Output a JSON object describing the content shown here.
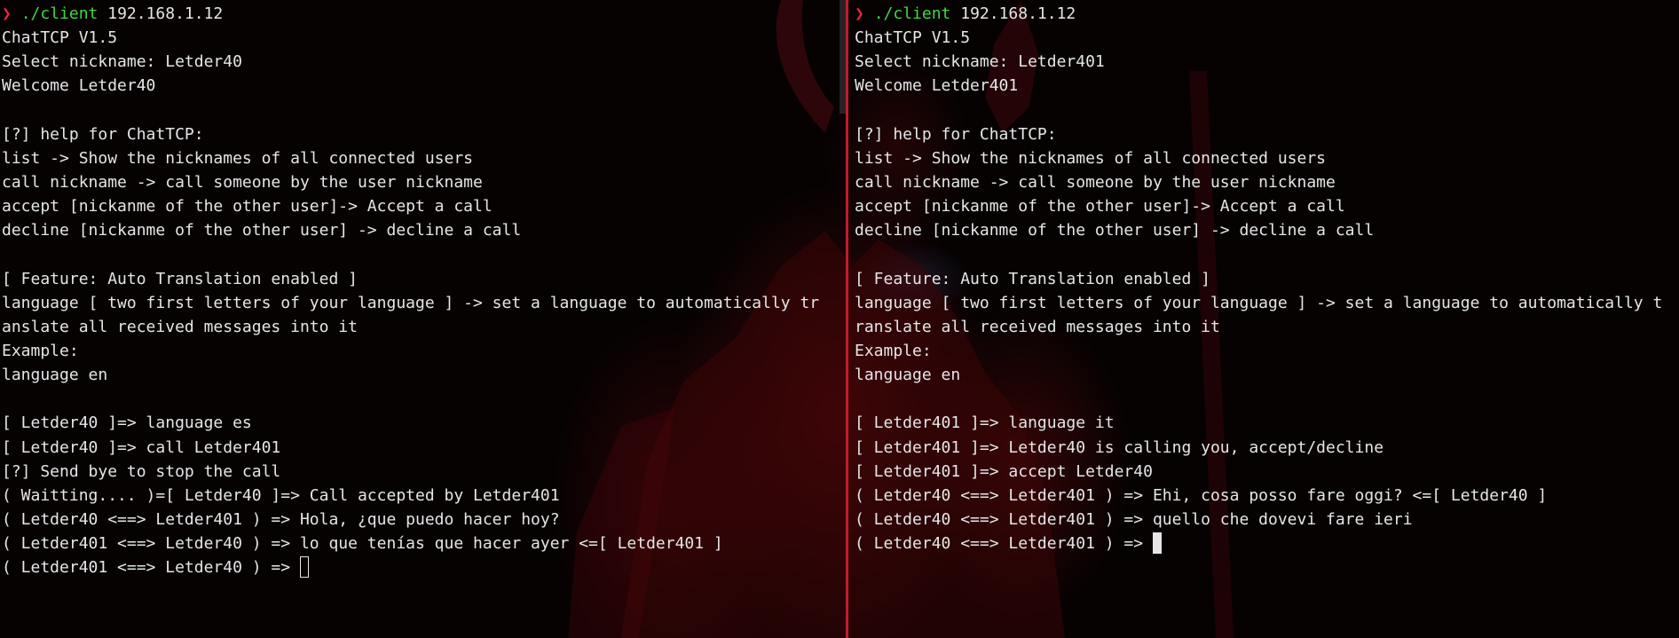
{
  "left_pane": {
    "prompt_symbol": "❯",
    "prompt_command": "./client",
    "prompt_arg": " 192.168.1.12",
    "lines": [
      "ChatTCP V1.5",
      "Select nickname: Letder40",
      "Welcome Letder40",
      "",
      "[?] help for ChatTCP:",
      "list -> Show the nicknames of all connected users",
      "call nickname -> call someone by the user nickname",
      "accept [nickanme of the other user]-> Accept a call",
      "decline [nickanme of the other user] -> decline a call",
      "",
      "[ Feature: Auto Translation enabled ]",
      "language [ two first letters of your language ] -> set a language to automatically tr",
      "anslate all received messages into it",
      "Example:",
      "language en",
      "",
      "[ Letder40 ]=> language es",
      "[ Letder40 ]=> call Letder401",
      "[?] Send bye to stop the call",
      "( Waitting.... )=[ Letder40 ]=> Call accepted by Letder401",
      "( Letder40 <==> Letder401 ) => Hola, ¿que puedo hacer hoy?",
      "( Letder401 <==> Letder40 ) => lo que tenías que hacer ayer <=[ Letder401 ]"
    ],
    "input_prompt": "( Letder401 <==> Letder40 ) => "
  },
  "right_pane": {
    "prompt_symbol": "❯",
    "prompt_command": "./client",
    "prompt_arg": " 192.168.1.12",
    "lines": [
      "ChatTCP V1.5",
      "Select nickname: Letder401",
      "Welcome Letder401",
      "",
      "[?] help for ChatTCP:",
      "list -> Show the nicknames of all connected users",
      "call nickname -> call someone by the user nickname",
      "accept [nickanme of the other user]-> Accept a call",
      "decline [nickanme of the other user] -> decline a call",
      "",
      "[ Feature: Auto Translation enabled ]",
      "language [ two first letters of your language ] -> set a language to automatically t",
      "ranslate all received messages into it",
      "Example:",
      "language en",
      "",
      "[ Letder401 ]=> language it",
      "[ Letder401 ]=> Letder40 is calling you, accept/decline",
      "[ Letder401 ]=> accept Letder40",
      "( Letder40 <==> Letder401 ) => Ehi, cosa posso fare oggi? <=[ Letder40 ]",
      "( Letder40 <==> Letder401 ) => quello che dovevi fare ieri"
    ],
    "input_prompt": "( Letder40 <==> Letder401 ) => "
  },
  "colors": {
    "text": "#e6e6e6",
    "prompt_arrow": "#e8263a",
    "prompt_command": "#3fd93f",
    "divider": "#c41a2d",
    "background": "#060202"
  }
}
